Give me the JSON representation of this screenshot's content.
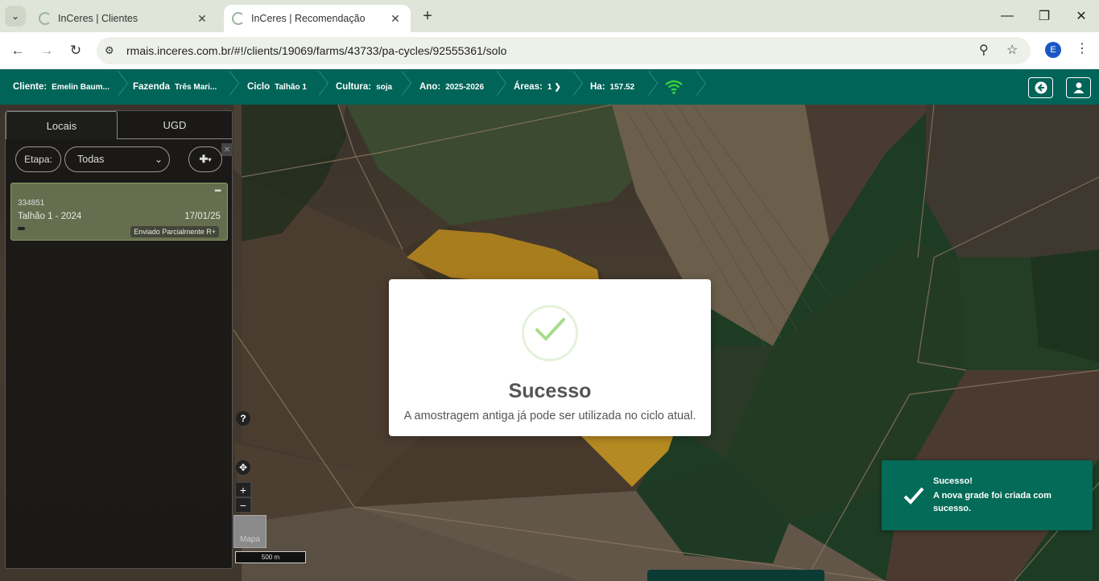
{
  "browser": {
    "tabs": [
      {
        "title": "InCeres | Clientes",
        "active": false
      },
      {
        "title": "InCeres | Recomendação",
        "active": true
      }
    ],
    "url": "rmais.inceres.com.br/#!/clients/19069/farms/43733/pa-cycles/92555361/solo",
    "profile_initial": "E"
  },
  "header": {
    "cliente_label": "Cliente:",
    "cliente_value": "Emelin Baum...",
    "fazenda_label": "Fazenda",
    "fazenda_value": "Três Mari...",
    "ciclo_label": "Ciclo",
    "ciclo_value": "Talhão 1",
    "cultura_label": "Cultura:",
    "cultura_value": "soja",
    "ano_label": "Ano:",
    "ano_value": "2025-2026",
    "areas_label": "Áreas:",
    "areas_value": "1",
    "ha_label": "Ha:",
    "ha_value": "157.52",
    "connection_color": "#3cd63c"
  },
  "panel": {
    "tabs": [
      "Locais",
      "UGD"
    ],
    "etapa_label": "Etapa:",
    "etapa_selected": "Todas",
    "card": {
      "id": "334851",
      "name": "Talhão 1 - 2024",
      "date": "17/01/25",
      "status": "Enviado Parcialmente R+"
    }
  },
  "map": {
    "help": "?",
    "zoom_in": "+",
    "zoom_out": "−",
    "layer_label": "Mapa",
    "scale_label": "500 m"
  },
  "modal": {
    "title": "Sucesso",
    "message": "A amostragem antiga já pode ser utilizada no ciclo atual."
  },
  "toast": {
    "title": "Sucesso!",
    "message": "A nova grade foi criada com sucesso."
  },
  "colors": {
    "brand": "#006459",
    "toast": "#036b58",
    "success_check": "#a6dc8b"
  }
}
